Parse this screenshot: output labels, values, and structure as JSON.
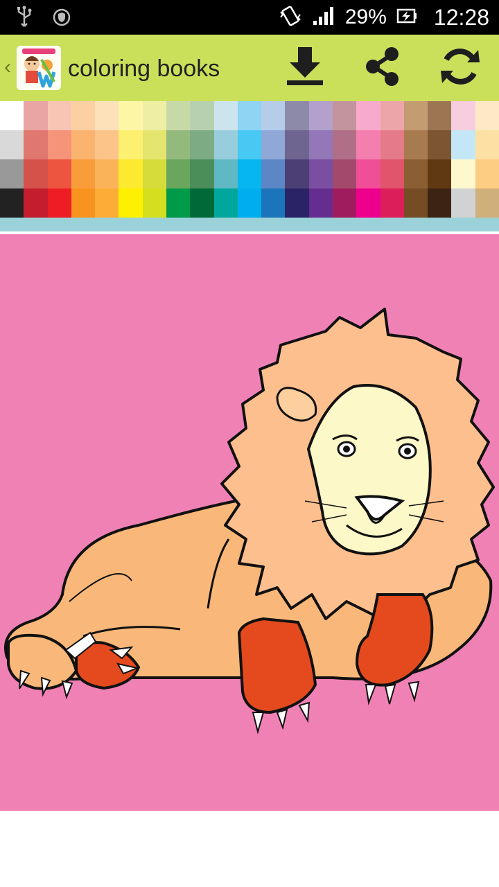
{
  "status_bar": {
    "battery_percent_text": "29%",
    "time": "12:28",
    "icons": [
      "usb-icon",
      "vpn-shield-icon",
      "vibrate-icon",
      "signal-icon",
      "battery-charging-icon"
    ]
  },
  "action_bar": {
    "title": "coloring books",
    "actions": [
      "download-icon",
      "share-icon",
      "refresh-icon"
    ],
    "background_color": "#cbe05a"
  },
  "palette": {
    "colors": [
      [
        "#ffffff",
        "#d9d9d9",
        "#999999",
        "#222222"
      ],
      [
        "#e8a5a3",
        "#e0786f",
        "#d5524b",
        "#c41e2e"
      ],
      [
        "#f8c5b5",
        "#f59478",
        "#ee5540",
        "#ee1d23"
      ],
      [
        "#fdd0a4",
        "#fbb46f",
        "#f99d3b",
        "#f7931e"
      ],
      [
        "#fde1b9",
        "#fcc489",
        "#fbb35a",
        "#fbad38"
      ],
      [
        "#fef6a7",
        "#fdf071",
        "#fde92f",
        "#fef100"
      ],
      [
        "#eeefa4",
        "#e3e56e",
        "#d6dd3a",
        "#d5df1f"
      ],
      [
        "#c8d9a8",
        "#93ba7c",
        "#6aa65e",
        "#019a48"
      ],
      [
        "#b7d1b0",
        "#7cab84",
        "#4c8e5a",
        "#006938"
      ],
      [
        "#cce4ee",
        "#97cddc",
        "#5fb8c3",
        "#00a79d"
      ],
      [
        "#8fd4f3",
        "#48c9f3",
        "#05b6ef",
        "#00aeef"
      ],
      [
        "#b6cdea",
        "#8fa8d8",
        "#5d86c6",
        "#1c75bb"
      ],
      [
        "#8c8aa8",
        "#6e6590",
        "#4c3f76",
        "#2a2466"
      ],
      [
        "#b4a0cc",
        "#9377b8",
        "#7a4ea0",
        "#662d91"
      ],
      [
        "#c3949d",
        "#b06f86",
        "#a34a6c",
        "#9f1d5f"
      ],
      [
        "#f7aacb",
        "#f47fae",
        "#f04e97",
        "#ec008c"
      ],
      [
        "#eca6aa",
        "#e57b8a",
        "#e0546c",
        "#dc1f5b"
      ],
      [
        "#c49c71",
        "#a87b4f",
        "#8b5e34",
        "#754c24"
      ],
      [
        "#9c7653",
        "#7e5532",
        "#603812",
        "#3c2414"
      ],
      [
        "#f8cde0",
        "#c3e7f6",
        "#fef9cd",
        "#d1d2d4"
      ],
      [
        "#fde9c5",
        "#fde0a4",
        "#fdcd83",
        "#cfb07a"
      ]
    ],
    "strip_color": "#9bd1d8"
  },
  "canvas": {
    "image": "lion coloring page",
    "background_color": "#f081b5",
    "mane_color": "#fdbf8e",
    "face_color": "#fdf8c8",
    "body_color": "#f9b879",
    "paw_color": "#e44a1d"
  }
}
